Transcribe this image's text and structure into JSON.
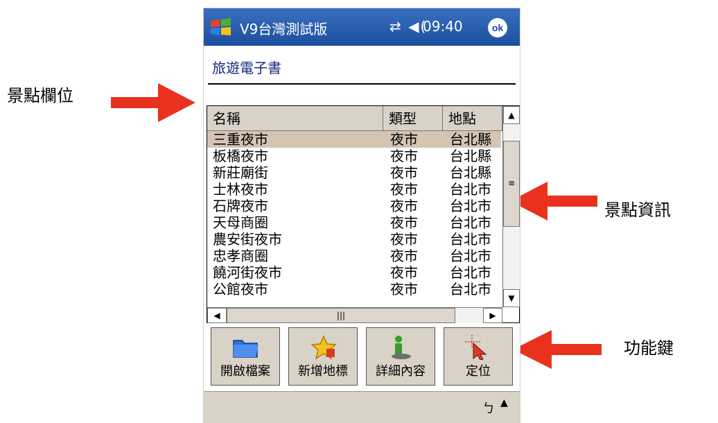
{
  "annotations": {
    "field_label": "景點欄位",
    "info_label": "景點資訊",
    "function_label": "功能鍵"
  },
  "titlebar": {
    "title": "V9台灣測試版",
    "status_icons": "⇄ ◀(",
    "time": "09:40",
    "ok_label": "ok"
  },
  "app": {
    "title": "旅遊電子書"
  },
  "list": {
    "headers": [
      "名稱",
      "類型",
      "地點"
    ],
    "rows": [
      {
        "name": "三重夜市",
        "type": "夜市",
        "place": "台北縣"
      },
      {
        "name": "板橋夜市",
        "type": "夜市",
        "place": "台北縣"
      },
      {
        "name": "新莊廟街",
        "type": "夜市",
        "place": "台北縣"
      },
      {
        "name": "士林夜市",
        "type": "夜市",
        "place": "台北市"
      },
      {
        "name": "石牌夜市",
        "type": "夜市",
        "place": "台北市"
      },
      {
        "name": "天母商圈",
        "type": "夜市",
        "place": "台北市"
      },
      {
        "name": "農安街夜市",
        "type": "夜市",
        "place": "台北市"
      },
      {
        "name": "忠孝商圈",
        "type": "夜市",
        "place": "台北市"
      },
      {
        "name": "饒河街夜市",
        "type": "夜市",
        "place": "台北市"
      },
      {
        "name": "公館夜市",
        "type": "夜市",
        "place": "台北市"
      }
    ]
  },
  "toolbar": {
    "open_file": "開啟檔案",
    "add_landmark": "新增地標",
    "details": "詳細內容",
    "locate": "定位"
  },
  "icons": {
    "folder": "folder-icon",
    "star": "star-icon",
    "info": "info-icon",
    "locate": "cursor-target-icon"
  },
  "colors": {
    "titlebar": "#1c4f9d",
    "selection": "#d5c3b3",
    "arrow": "#e8321e"
  }
}
